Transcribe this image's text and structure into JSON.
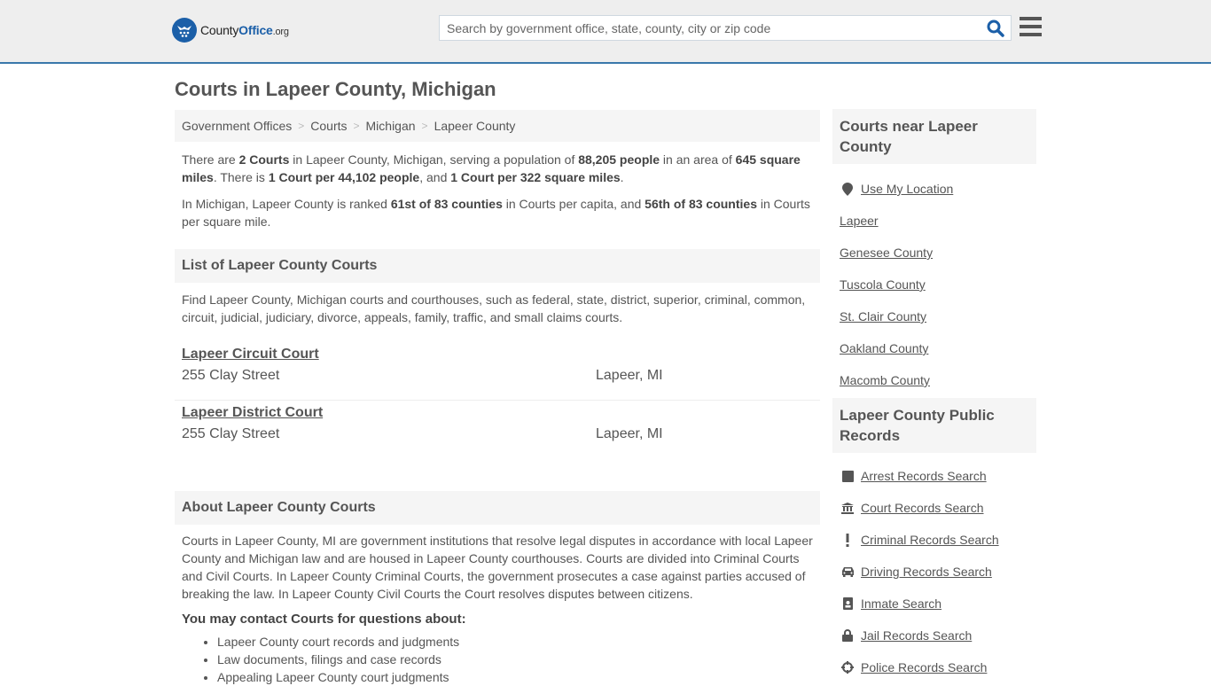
{
  "header": {
    "logo": {
      "word1": "County",
      "word2": "Office",
      "suffix": ".org"
    },
    "search": {
      "placeholder": "Search by government office, state, county, city or zip code",
      "value": ""
    },
    "search_icon": "search-icon",
    "menu_icon": "hamburger-menu-icon"
  },
  "page_title": "Courts in Lapeer County, Michigan",
  "breadcrumb": [
    "Government Offices",
    "Courts",
    "Michigan",
    "Lapeer County"
  ],
  "summary": {
    "p1": {
      "t1": "There are ",
      "b1": "2 Courts",
      "t2": " in Lapeer County, Michigan, serving a population of ",
      "b2": "88,205 people",
      "t3": " in an area of ",
      "b3": "645 square miles",
      "t4": ". There is ",
      "b4": "1 Court per 44,102 people",
      "t5": ", and ",
      "b5": "1 Court per 322 square miles",
      "t6": "."
    },
    "p2": {
      "t1": "In Michigan, Lapeer County is ranked ",
      "b1": "61st of 83 counties",
      "t2": " in Courts per capita, and ",
      "b2": "56th of 83 counties",
      "t3": " in Courts per square mile."
    }
  },
  "list_section": {
    "title": "List of Lapeer County Courts",
    "intro": "Find Lapeer County, Michigan courts and courthouses, such as federal, state, district, superior, criminal, common, circuit, judicial, judiciary, divorce, appeals, family, traffic, and small claims courts.",
    "courts": [
      {
        "name": "Lapeer Circuit Court",
        "address": "255 Clay Street",
        "city": "Lapeer, MI"
      },
      {
        "name": "Lapeer District Court",
        "address": "255 Clay Street",
        "city": "Lapeer, MI"
      }
    ]
  },
  "about_section": {
    "title": "About Lapeer County Courts",
    "text": "Courts in Lapeer County, MI are government institutions that resolve legal disputes in accordance with local Lapeer County and Michigan law and are housed in Lapeer County courthouses. Courts are divided into Criminal Courts and Civil Courts. In Lapeer County Criminal Courts, the government prosecutes a case against parties accused of breaking the law. In Lapeer County Civil Courts the Court resolves disputes between citizens.",
    "contact_heading": "You may contact Courts for questions about:",
    "contact_items": [
      "Lapeer County court records and judgments",
      "Law documents, filings and case records",
      "Appealing Lapeer County court judgments"
    ]
  },
  "sidebar": {
    "near_title": "Courts near Lapeer County",
    "use_location": "Use My Location",
    "near_links": [
      "Lapeer",
      "Genesee County",
      "Tuscola County",
      "St. Clair County",
      "Oakland County",
      "Macomb County"
    ],
    "records_title": "Lapeer County Public Records",
    "records_links": [
      {
        "label": "Arrest Records Search",
        "icon": "square-icon"
      },
      {
        "label": "Court Records Search",
        "icon": "courthouse-icon"
      },
      {
        "label": "Criminal Records Search",
        "icon": "exclamation-icon"
      },
      {
        "label": "Driving Records Search",
        "icon": "car-icon"
      },
      {
        "label": "Inmate Search",
        "icon": "id-badge-icon"
      },
      {
        "label": "Jail Records Search",
        "icon": "lock-icon"
      },
      {
        "label": "Police Records Search",
        "icon": "crosshairs-icon"
      }
    ]
  },
  "colors": {
    "brand_blue": "#1b5fa8",
    "header_border": "#3a78ab",
    "header_bg": "#eeeeee",
    "panel_bg": "#f5f5f5",
    "text": "#555555"
  }
}
